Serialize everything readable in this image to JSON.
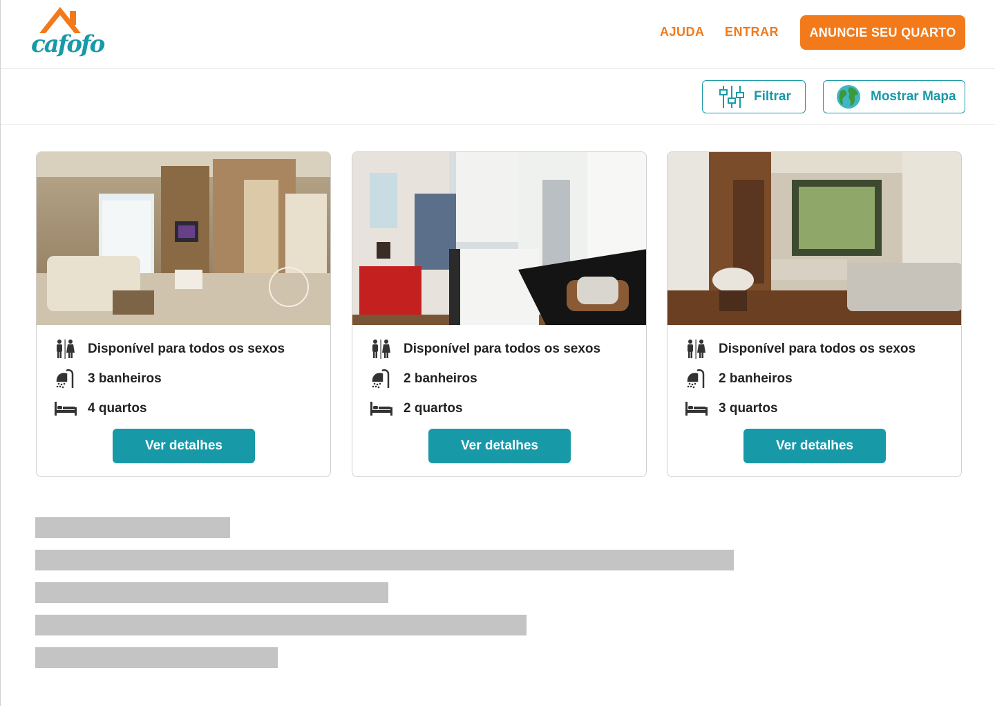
{
  "brand": {
    "logo_text": "cafofo",
    "primary_color": "#1899a8",
    "accent_color": "#f27a1a"
  },
  "nav": {
    "help_label": "AJUDA",
    "login_label": "ENTRAR",
    "cta_label": "ANUNCIE SEU QUARTO"
  },
  "toolbar": {
    "filter_label": "Filtrar",
    "map_label": "Mostrar Mapa",
    "filter_icon": "sliders-icon",
    "map_icon": "globe-icon"
  },
  "listings": [
    {
      "photo": "living-room-photo",
      "gender": "Disponível para todos os sexos",
      "bathrooms": "3 banheiros",
      "bedrooms": "4 quartos",
      "button": "Ver detalhes"
    },
    {
      "photo": "kitchen-living-photo",
      "gender": "Disponível para todos os sexos",
      "bathrooms": "2 banheiros",
      "bedrooms": "2 quartos",
      "button": "Ver detalhes"
    },
    {
      "photo": "lounge-photo",
      "gender": "Disponível para todos os sexos",
      "bathrooms": "2 banheiros",
      "bedrooms": "3 quartos",
      "button": "Ver detalhes"
    }
  ],
  "icons": {
    "gender": "restroom-icon",
    "bathrooms": "shower-icon",
    "bedrooms": "bed-icon"
  },
  "placeholder_lines": 5
}
